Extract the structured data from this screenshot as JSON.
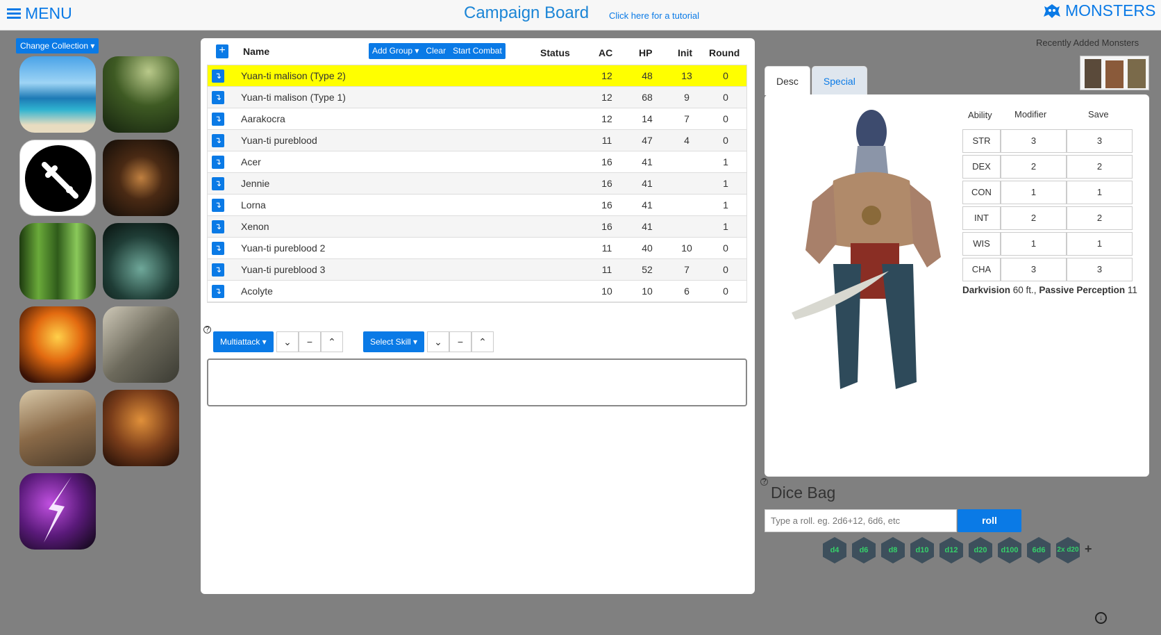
{
  "header": {
    "menu": "MENU",
    "title": "Campaign Board",
    "tutorial": "Click here for a tutorial",
    "monsters": "MONSTERS"
  },
  "left": {
    "change_collection": "Change Collection ▾"
  },
  "tracker": {
    "add_group": "Add Group ▾",
    "clear": "Clear",
    "start_combat": "Start Combat",
    "columns": {
      "name": "Name",
      "status": "Status",
      "ac": "AC",
      "hp": "HP",
      "init": "Init",
      "round": "Round"
    },
    "rows": [
      {
        "name": "Yuan-ti malison (Type 2)",
        "ac": "12",
        "hp": "48",
        "init": "13",
        "round": "0"
      },
      {
        "name": "Yuan-ti malison (Type 1)",
        "ac": "12",
        "hp": "68",
        "init": "9",
        "round": "0"
      },
      {
        "name": "Aarakocra",
        "ac": "12",
        "hp": "14",
        "init": "7",
        "round": "0"
      },
      {
        "name": "Yuan-ti pureblood",
        "ac": "11",
        "hp": "47",
        "init": "4",
        "round": "0"
      },
      {
        "name": "Acer",
        "ac": "16",
        "hp": "41",
        "init": "",
        "round": "1"
      },
      {
        "name": "Jennie",
        "ac": "16",
        "hp": "41",
        "init": "",
        "round": "1"
      },
      {
        "name": "Lorna",
        "ac": "16",
        "hp": "41",
        "init": "",
        "round": "1"
      },
      {
        "name": "Xenon",
        "ac": "16",
        "hp": "41",
        "init": "",
        "round": "1"
      },
      {
        "name": "Yuan-ti pureblood 2",
        "ac": "11",
        "hp": "40",
        "init": "10",
        "round": "0"
      },
      {
        "name": "Yuan-ti pureblood 3",
        "ac": "11",
        "hp": "52",
        "init": "7",
        "round": "0"
      },
      {
        "name": "Acolyte",
        "ac": "10",
        "hp": "10",
        "init": "6",
        "round": "0"
      }
    ],
    "multiattack": "Multiattack ▾",
    "select_skill": "Select Skill ▾"
  },
  "right": {
    "recent": "Recently Added Monsters",
    "tabs": [
      "Desc",
      "Special"
    ],
    "ability_headers": [
      "Ability",
      "Modifier",
      "Save"
    ],
    "abilities": [
      {
        "name": "STR",
        "mod": "3",
        "save": "3"
      },
      {
        "name": "DEX",
        "mod": "2",
        "save": "2"
      },
      {
        "name": "CON",
        "mod": "1",
        "save": "1"
      },
      {
        "name": "INT",
        "mod": "2",
        "save": "2"
      },
      {
        "name": "WIS",
        "mod": "1",
        "save": "1"
      },
      {
        "name": "CHA",
        "mod": "3",
        "save": "3"
      }
    ],
    "senses_a": "Darkvision",
    "senses_b": " 60 ft., ",
    "senses_c": "Passive Perception",
    "senses_d": " 11"
  },
  "dice": {
    "title": "Dice Bag",
    "placeholder": "Type a roll. eg. 2d6+12, 6d6, etc",
    "roll": "roll",
    "dice": [
      "d4",
      "d6",
      "d8",
      "d10",
      "d12",
      "d20",
      "d100",
      "6d6",
      "2x d20"
    ]
  },
  "colors": {
    "accent": "#0a7ae6",
    "highlight": "#ffff00",
    "background": "#808080"
  }
}
